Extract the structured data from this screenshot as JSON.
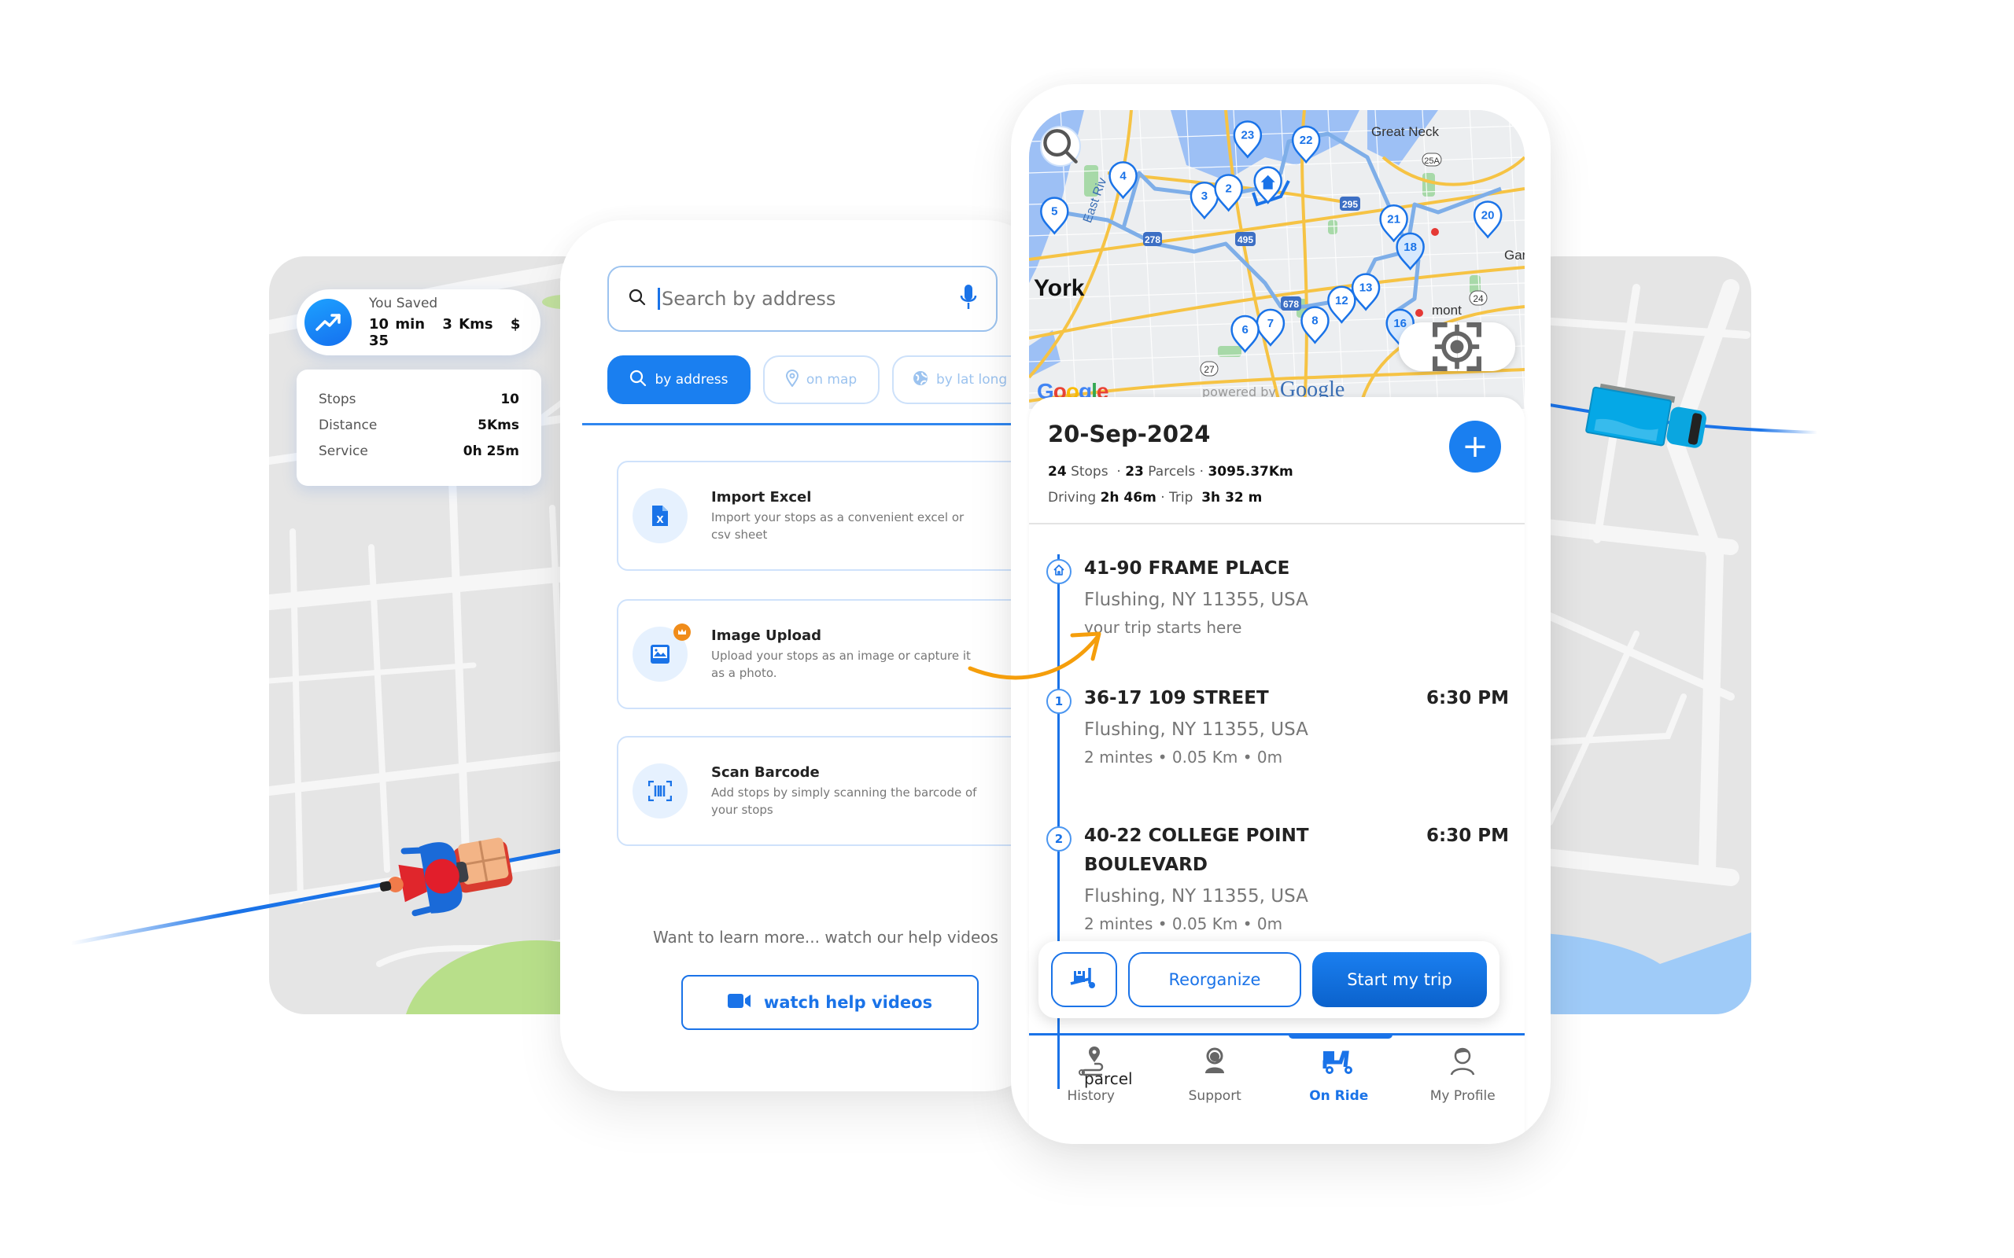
{
  "savings": {
    "title": "You Saved",
    "icon": "trending-up-icon",
    "time": "10 min",
    "distance": "3 Kms",
    "money": "$ 35"
  },
  "summary": {
    "rows": [
      {
        "label": "Stops",
        "value": "10"
      },
      {
        "label": "Distance",
        "value": "5Kms"
      },
      {
        "label": "Service",
        "value": "0h 25m"
      }
    ]
  },
  "add_stops": {
    "search": {
      "placeholder": "Search by address",
      "value": ""
    },
    "chips": [
      {
        "label": "by address",
        "icon": "search-icon",
        "active": true
      },
      {
        "label": "on map",
        "icon": "map-pin-icon",
        "active": false
      },
      {
        "label": "by lat long",
        "icon": "globe-icon",
        "active": false
      }
    ],
    "options": [
      {
        "title": "Import Excel",
        "description": "Import your stops as a convenient excel or csv sheet",
        "icon": "excel-file-icon"
      },
      {
        "title": "Image Upload",
        "description": "Upload your stops as an image or capture it as a photo.",
        "icon": "image-icon",
        "badge": "crown-icon"
      },
      {
        "title": "Scan Barcode",
        "description": "Add stops by simply scanning the barcode of your stops",
        "icon": "barcode-scan-icon"
      }
    ],
    "learn_text": "Want to learn more... watch our help videos",
    "watch_button": "watch help videos"
  },
  "map": {
    "labels": [
      "Great Neck",
      "York",
      "East Riv",
      "Gar",
      "mont"
    ],
    "road_shields": [
      "25A",
      "295",
      "278",
      "495",
      "678",
      "24",
      "27"
    ],
    "pins": [
      "23",
      "22",
      "4",
      "3",
      "2",
      "5",
      "21",
      "18",
      "20",
      "13",
      "12",
      "7",
      "6",
      "8",
      "16"
    ],
    "attribution": "Google",
    "powered_by": "powered by",
    "powered_brand": "Google"
  },
  "trip": {
    "date": "20-Sep-2024",
    "stops_count": "24",
    "stops_label": "Stops",
    "parcels_count": "23",
    "parcels_label": "Parcels",
    "distance": "3095.37Km",
    "driving_label": "Driving",
    "driving_time": "2h 46m",
    "trip_label": "Trip",
    "trip_time": "3h 32 m",
    "stops": [
      {
        "marker": "home",
        "title": "41-90 FRAME PLACE",
        "city": "Flushing, NY 11355, USA",
        "meta": "your trip starts here",
        "time": ""
      },
      {
        "marker": "1",
        "title": "36-17 109 STREET",
        "city": "Flushing, NY 11355, USA",
        "meta": "2 mintes  • 0.05 Km • 0m",
        "time": "6:30 PM"
      },
      {
        "marker": "2",
        "title": "40-22 COLLEGE POINT BOULEVARD",
        "city": "Flushing, NY 11355, USA",
        "meta": "2 mintes  • 0.05 Km • 0m",
        "time": "6:30 PM"
      }
    ],
    "partial_text": "parcel",
    "actions": {
      "reorganize": "Reorganize",
      "start": "Start my trip"
    }
  },
  "bottom_nav": [
    {
      "label": "History",
      "icon": "history-route-icon",
      "active": false
    },
    {
      "label": "Support",
      "icon": "support-agent-icon",
      "active": false
    },
    {
      "label": "On Ride",
      "icon": "scooter-icon",
      "active": true
    },
    {
      "label": "My Profile",
      "icon": "profile-icon",
      "active": false
    }
  ],
  "colors": {
    "primary": "#1a73e8",
    "accent_orange": "#f59e0b",
    "map_gray": "#e5e5e5"
  }
}
